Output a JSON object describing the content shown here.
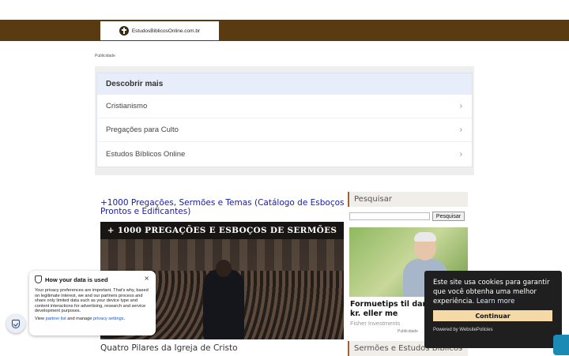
{
  "header": {
    "logo_text": "EstudosBiblicosOnline.com.br"
  },
  "ad_label": "Publicidade",
  "discover": {
    "title": "Descobrir mais",
    "items": [
      {
        "label": "Cristianismo"
      },
      {
        "label": "Pregações para Culto"
      },
      {
        "label": "Estudos Bíblicos Online"
      }
    ]
  },
  "posts": [
    {
      "title": "+1000 Pregações, Sermões e Temas (Catálogo de Esboços Prontos e Edificantes)",
      "banner": "+ 1000 PREGAÇÕES E ESBOÇOS DE SERMÕES"
    },
    {
      "title": "Quatro Pilares da Igreja de Cristo"
    }
  ],
  "sidebar": {
    "search_heading": "Pesquisar",
    "search_button": "Pesquisar",
    "ad": {
      "headline": "Formuetips til dan 3 mio. kr. eller me",
      "source": "Fisher Investments",
      "tag": "Publicidade"
    },
    "section2_heading": "Sermões e Estudos Bíblicos"
  },
  "privacy": {
    "title": "How your data is used",
    "close": "×",
    "body": "Your privacy preferences are important. That's why, based on legitimate interest, we and our partners process and share only limited data such as your device type and content interactions for advertising, research and service development purposes.",
    "links_prefix": "View",
    "partner_link": "partner list",
    "links_mid": "and manage",
    "settings_link": "privacy settings",
    "links_suffix": "."
  },
  "cookie": {
    "text": "Este site usa cookies para garantir que você obtenha uma melhor experiência.",
    "learn_more": "Learn more",
    "button": "Continuar",
    "powered": "Powered by WebsitePolicies"
  },
  "colors": {
    "header_brown": "#5a3a10",
    "link_blue": "#1a1aa6",
    "cookie_button": "#f5d9a6"
  }
}
